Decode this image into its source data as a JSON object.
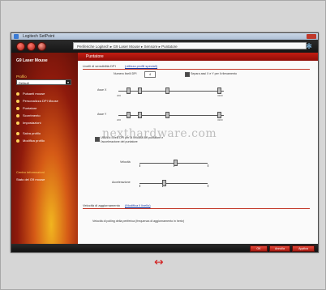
{
  "window": {
    "title": "Logitech SetPoint",
    "address_path": "Periferiche Logitech ▸ G9 Laser Mouse ▸ Sensore ▸ Puntatore"
  },
  "sidebar": {
    "product": "G9 Laser Mouse",
    "profile_label": "Profilo",
    "profile_value": "Default",
    "items": [
      {
        "label": "Pulsanti mouse"
      },
      {
        "label": "Personalizza DPI Mouse"
      },
      {
        "label": "Puntatore"
      },
      {
        "label": "Scorrimento"
      },
      {
        "label": "Impostazioni"
      },
      {
        "label": "Salva profilo"
      },
      {
        "label": "Modifica profilo"
      }
    ],
    "info_title": "Centro informazioni",
    "info_text": "Stato del G9 mouse"
  },
  "content": {
    "header_title": "Puntatore",
    "section1_label": "Livelli di sensibilità DPI",
    "section1_link": "(utilizza profili speciali)",
    "default_level_label": "Numero livelli DPI",
    "default_level_value": "4",
    "checkbox1_label": "Separa assi X e Y per il rilevamento",
    "axis_x_label": "Asse X",
    "axis_y_label": "Asse Y",
    "tick_min": "200",
    "tick_max": "3200",
    "checkbox2_label": "Utilizza i livelli DPI per la velocità del puntatore e l'accelerazione del puntatore",
    "speed_label": "Velocità",
    "accel_label": "Accelerazione",
    "section2_label": "Velocità di aggiornamento",
    "section2_link": "(Modifica il livello)",
    "section2_note": "Velocità di polling della periferica (frequenza di aggiornamento in hertz)",
    "watermark": "nexthardware.com"
  },
  "footer": {
    "ok": "OK",
    "cancel": "Annulla",
    "apply": "Applica"
  },
  "colors": {
    "accent": "#c21d12",
    "sidebar_glow": "#f1b51f"
  }
}
